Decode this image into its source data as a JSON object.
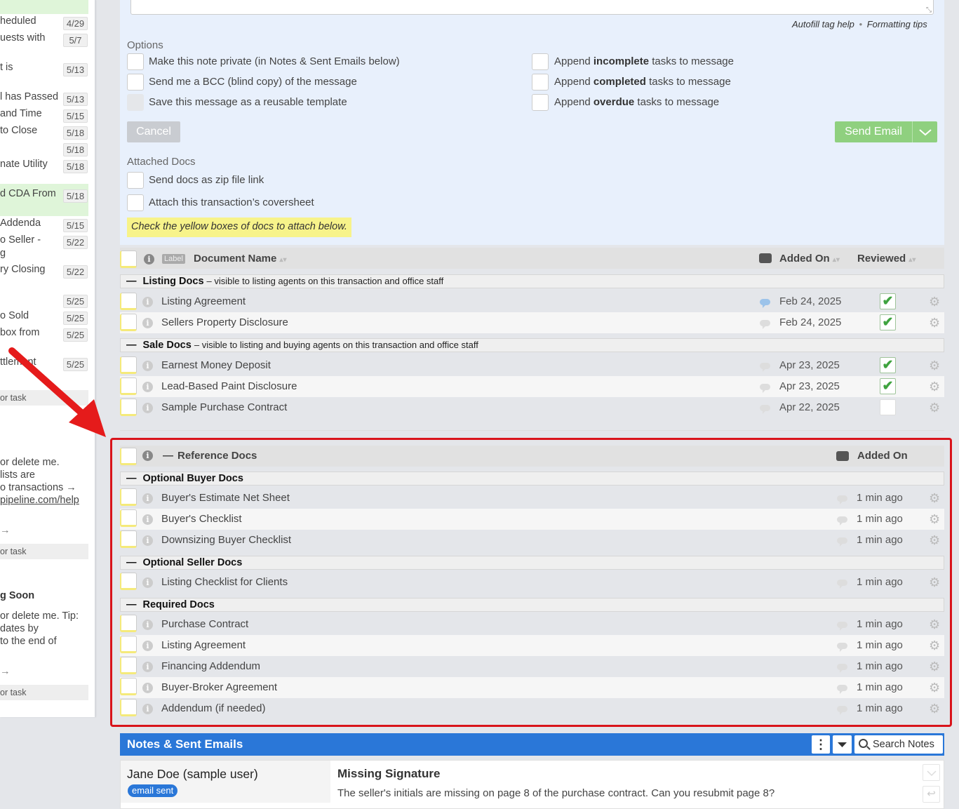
{
  "left_column": {
    "tasks": [
      {
        "text": "heduled",
        "date": "4/29"
      },
      {
        "text": "uests with",
        "date": "5/7"
      },
      {
        "text": "t is",
        "date": "5/13"
      },
      {
        "text": "l has Passed",
        "date": "5/13"
      },
      {
        "text": "and Time",
        "date": "5/15"
      },
      {
        "text": "to Close",
        "date": "5/18"
      },
      {
        "text": "",
        "date": "5/18"
      },
      {
        "text": "nate Utility",
        "date": "5/18"
      },
      {
        "text": "d CDA From",
        "date": "5/18"
      },
      {
        "text": "Addenda",
        "date": "5/15"
      },
      {
        "text": "o Seller -",
        "date": "5/22"
      },
      {
        "text": "g",
        "date": ""
      },
      {
        "text": "ry Closing",
        "date": "5/22"
      },
      {
        "text": "",
        "date": "5/25"
      },
      {
        "text": "o Sold",
        "date": "5/25"
      },
      {
        "text": "box from",
        "date": "5/25"
      },
      {
        "text": "ttlement",
        "date": "5/25"
      }
    ],
    "task_bar_1": "or task",
    "note1": [
      "or delete me.",
      "lists are",
      "o transactions →",
      "pipeline.com/help"
    ],
    "arrow_1": "→",
    "task_bar_2": "or task",
    "soon": "g Soon",
    "note2": [
      "or delete me. Tip:",
      "dates by",
      "to the end of"
    ],
    "arrow_2": "→",
    "task_bar_3": "or task"
  },
  "email_form": {
    "autofill_help": "Autofill tag help",
    "sep": "•",
    "formatting_tips": "Formatting tips",
    "options_title": "Options",
    "options_left": [
      "Make this note private (in Notes & Sent Emails below)",
      "Send me a BCC (blind copy) of the message",
      "Save this message as a reusable template"
    ],
    "append_prefix": "Append",
    "append_suffix": "tasks to message",
    "append_words": [
      "incomplete",
      "completed",
      "overdue"
    ],
    "cancel_label": "Cancel",
    "send_label": "Send Email",
    "attached_title": "Attached Docs",
    "attached_options": [
      "Send docs as zip file link",
      "Attach this transaction’s coversheet"
    ],
    "yellow_hint": "Check the yellow boxes of docs to attach below."
  },
  "doc_table": {
    "header": {
      "label_tag": "Label",
      "name": "Document Name",
      "added_on": "Added On",
      "reviewed": "Reviewed"
    },
    "groups": [
      {
        "title": "Listing Docs",
        "note": "– visible to listing agents on this transaction and office staff",
        "docs": [
          {
            "name": "Listing Agreement",
            "date": "Feb 24, 2025",
            "reviewed": true,
            "comment": "blue"
          },
          {
            "name": "Sellers Property Disclosure",
            "date": "Feb 24, 2025",
            "reviewed": true,
            "comment": "gray"
          }
        ]
      },
      {
        "title": "Sale Docs",
        "note": "– visible to listing and buying agents on this transaction and office staff",
        "docs": [
          {
            "name": "Earnest Money Deposit",
            "date": "Apr 23, 2025",
            "reviewed": true,
            "comment": "gray"
          },
          {
            "name": "Lead-Based Paint Disclosure",
            "date": "Apr 23, 2025",
            "reviewed": true,
            "comment": "gray"
          },
          {
            "name": "Sample Purchase Contract",
            "date": "Apr 22, 2025",
            "reviewed": false,
            "comment": "gray"
          }
        ]
      }
    ]
  },
  "reference_docs": {
    "title": "Reference Docs",
    "collapse_glyph": "—",
    "added_on": "Added On",
    "groups": [
      {
        "title": "Optional Buyer Docs",
        "docs": [
          {
            "name": "Buyer's Estimate Net Sheet",
            "time": "1 min ago"
          },
          {
            "name": "Buyer's Checklist",
            "time": "1 min ago"
          },
          {
            "name": "Downsizing Buyer Checklist",
            "time": "1 min ago"
          }
        ]
      },
      {
        "title": "Optional Seller Docs",
        "docs": [
          {
            "name": "Listing Checklist for Clients",
            "time": "1 min ago"
          }
        ]
      },
      {
        "title": "Required Docs",
        "docs": [
          {
            "name": "Purchase Contract",
            "time": "1 min ago"
          },
          {
            "name": "Listing Agreement",
            "time": "1 min ago"
          },
          {
            "name": "Financing Addendum",
            "time": "1 min ago"
          },
          {
            "name": "Buyer-Broker Agreement",
            "time": "1 min ago"
          },
          {
            "name": "Addendum (if needed)",
            "time": "1 min ago"
          }
        ]
      }
    ]
  },
  "notes": {
    "title": "Notes & Sent Emails",
    "search_label": "Search Notes",
    "author": "Jane Doe (sample user)",
    "badge": "email sent",
    "subject": "Missing Signature",
    "body": "The seller's initials are missing on page 8 of the purchase contract. Can you resubmit page 8?"
  },
  "colors": {
    "accent_blue": "#2a77d8",
    "highlight_red": "#d9141b",
    "send_green": "#8fd07f",
    "panel_blue": "#e8f0fc",
    "yellow": "#f7f38a"
  },
  "icons": [
    "info-icon",
    "comment-icon",
    "gear-icon",
    "checkmark-icon",
    "chevron-down-icon",
    "search-icon",
    "kebab-icon",
    "red-arrow-annotation"
  ]
}
